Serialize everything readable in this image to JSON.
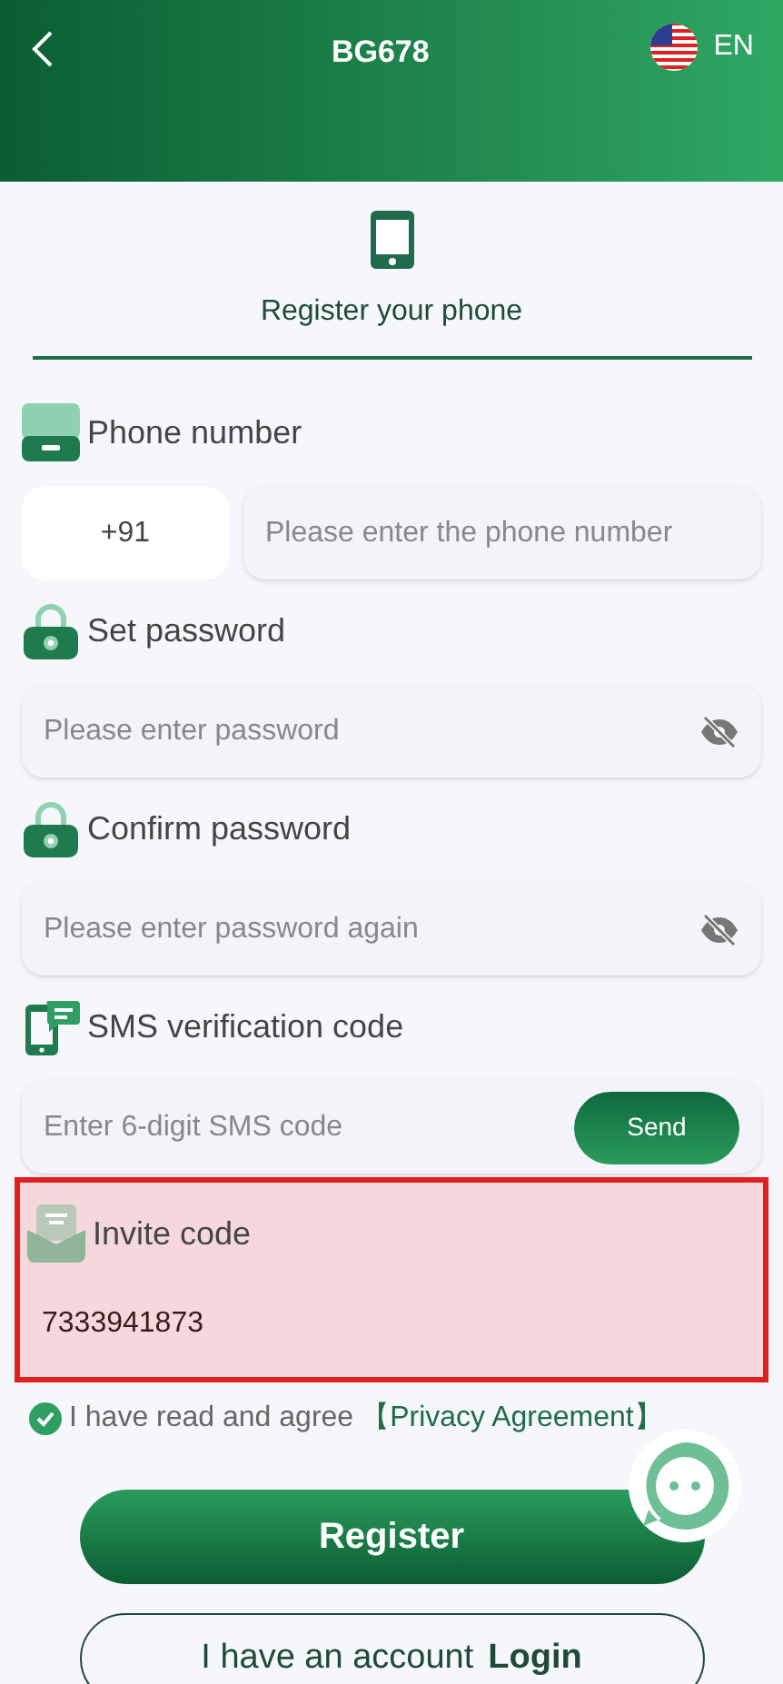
{
  "header": {
    "logo": "BG678",
    "language": "EN"
  },
  "tab": {
    "label": "Register your phone",
    "selected": true
  },
  "fields": [
    {
      "kind": "phone",
      "label": "Phone number",
      "prefix": "+91",
      "placeholder": "Please enter the phone number"
    },
    {
      "kind": "password",
      "label": "Set password",
      "placeholder": "Please enter password"
    },
    {
      "kind": "password",
      "label": "Confirm password",
      "placeholder": "Please enter password again"
    },
    {
      "kind": "sms",
      "label": "SMS verification code",
      "placeholder": "Enter 6-digit SMS code",
      "button": "Send"
    },
    {
      "kind": "invite",
      "label": "Invite code",
      "value": "7333941873",
      "highlighted": true
    }
  ],
  "agreement": {
    "checked": true,
    "text": "I have read and agree",
    "link": "【Privacy Agreement】"
  },
  "register_button": "Register",
  "login": {
    "text": "I have an account",
    "link": "Login"
  }
}
